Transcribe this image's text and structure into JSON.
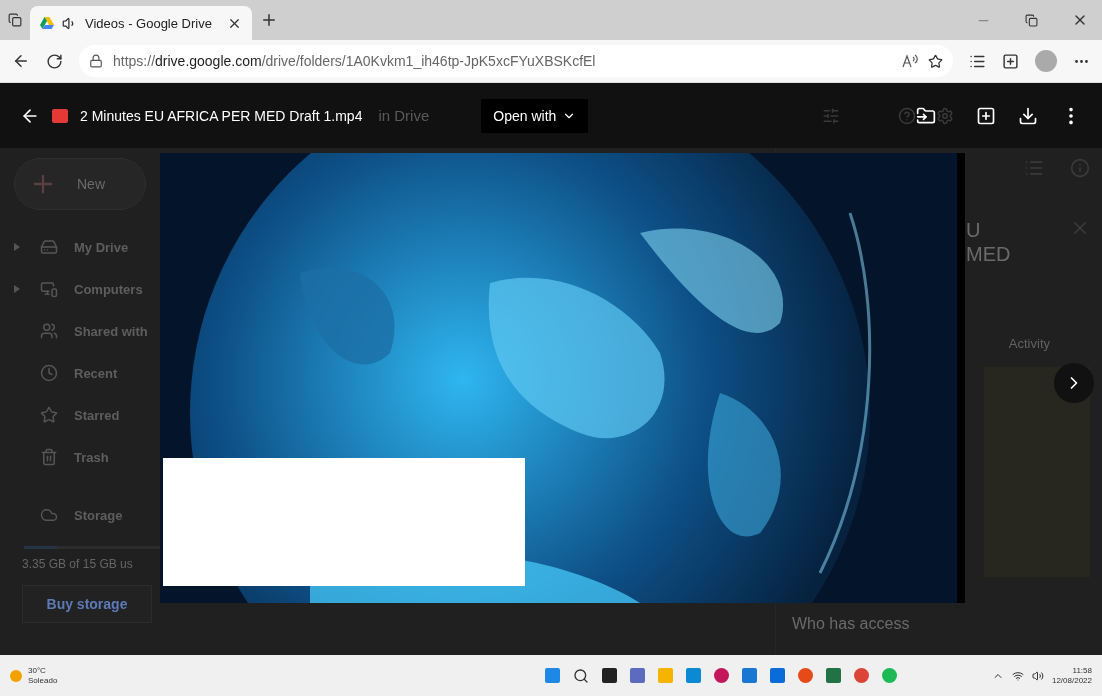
{
  "browser": {
    "tab": {
      "title": "Videos - Google Drive",
      "audio": true
    },
    "url_prefix": "https://",
    "url_host": "drive.google.com",
    "url_path": "/drive/folders/1A0Kvkm1_ih46tp-JpK5xcFYuXBSKcfEl"
  },
  "viewer": {
    "file_name": "2 Minutes EU AFRICA PER MED Draft 1.mp4",
    "open_with": "Open with"
  },
  "drive": {
    "header_text": "in Drive",
    "new_button": "New",
    "sidebar": [
      {
        "label": "My Drive",
        "expandable": true
      },
      {
        "label": "Computers",
        "expandable": true
      },
      {
        "label": "Shared with",
        "expandable": false
      },
      {
        "label": "Recent",
        "expandable": false
      },
      {
        "label": "Starred",
        "expandable": false
      },
      {
        "label": "Trash",
        "expandable": false
      }
    ],
    "storage": {
      "label": "Storage",
      "level": 0.22,
      "usage": "3.35 GB of 15 GB us"
    },
    "buy_storage": "Buy storage",
    "details": {
      "title_lines": [
        "U",
        "MED"
      ],
      "tab": "Activity",
      "section": "Who has access"
    }
  },
  "taskbar": {
    "weather": {
      "temp": "30°C",
      "condition": "Soleado"
    },
    "time": "11:58",
    "date": "12/08/2022"
  }
}
